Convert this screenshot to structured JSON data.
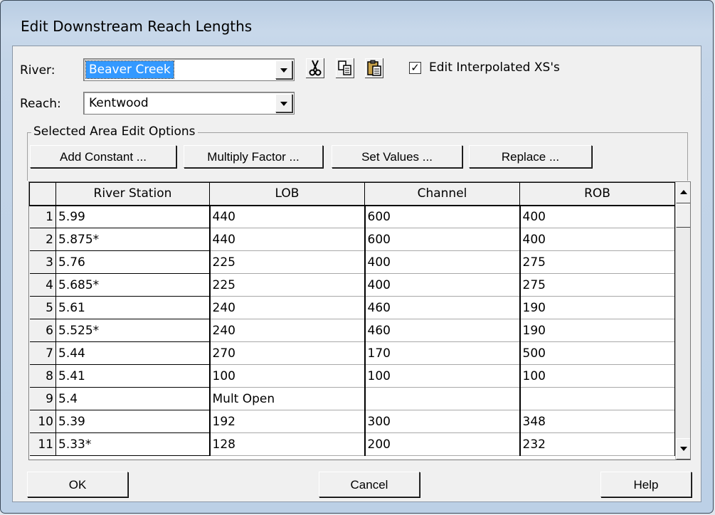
{
  "window": {
    "title": "Edit Downstream Reach Lengths"
  },
  "river": {
    "label": "River:",
    "value": "Beaver Creek"
  },
  "reach": {
    "label": "Reach:",
    "value": "Kentwood"
  },
  "toolbar": {
    "cut_icon": "scissors-icon",
    "copy_icon": "copy-icon",
    "paste_icon": "paste-icon",
    "checkbox_label": "Edit Interpolated XS's",
    "checkbox_checked": true
  },
  "edit_options": {
    "title": "Selected Area Edit Options",
    "add_constant": "Add Constant ...",
    "multiply_factor": "Multiply Factor ...",
    "set_values": "Set Values ...",
    "replace": "Replace ..."
  },
  "table": {
    "headers": [
      "River Station",
      "LOB",
      "Channel",
      "ROB"
    ],
    "rows": [
      {
        "n": "1",
        "station": "5.99",
        "lob": "440",
        "channel": "600",
        "rob": "400"
      },
      {
        "n": "2",
        "station": "5.875*",
        "lob": "440",
        "channel": "600",
        "rob": "400"
      },
      {
        "n": "3",
        "station": "5.76",
        "lob": "225",
        "channel": "400",
        "rob": "275"
      },
      {
        "n": "4",
        "station": "5.685*",
        "lob": "225",
        "channel": "400",
        "rob": "275"
      },
      {
        "n": "5",
        "station": "5.61",
        "lob": "240",
        "channel": "460",
        "rob": "190"
      },
      {
        "n": "6",
        "station": "5.525*",
        "lob": "240",
        "channel": "460",
        "rob": "190"
      },
      {
        "n": "7",
        "station": "5.44",
        "lob": "270",
        "channel": "170",
        "rob": "500"
      },
      {
        "n": "8",
        "station": "5.41",
        "lob": "100",
        "channel": "100",
        "rob": "100"
      },
      {
        "n": "9",
        "station": "5.4",
        "lob": "Mult Open",
        "channel": "",
        "rob": ""
      },
      {
        "n": "10",
        "station": "5.39",
        "lob": "192",
        "channel": "300",
        "rob": "348"
      },
      {
        "n": "11",
        "station": "5.33*",
        "lob": "128",
        "channel": "200",
        "rob": "232"
      }
    ]
  },
  "buttons": {
    "ok": "OK",
    "cancel": "Cancel",
    "help": "Help"
  }
}
